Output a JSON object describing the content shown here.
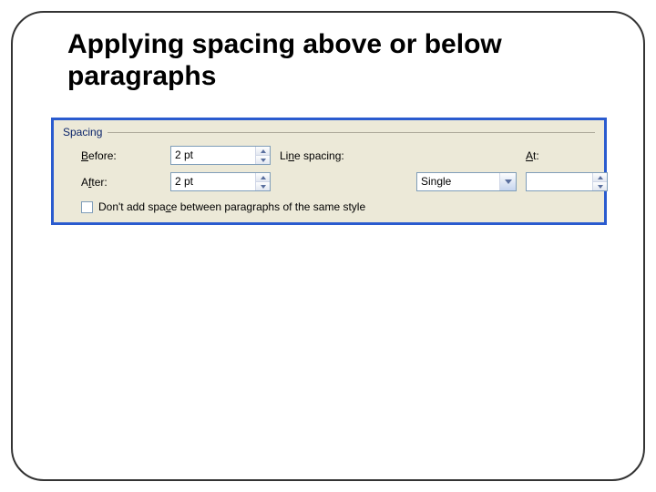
{
  "slide": {
    "title": "Applying spacing above or below paragraphs"
  },
  "spacing": {
    "group": "Spacing",
    "before": {
      "label_pre": "",
      "label_ul": "B",
      "label_post": "efore:",
      "value": "2 pt"
    },
    "after": {
      "label_pre": "A",
      "label_ul": "f",
      "label_post": "ter:",
      "value": "2 pt"
    },
    "line": {
      "label_pre": "Li",
      "label_ul": "n",
      "label_post": "e spacing:",
      "value": "Single"
    },
    "at": {
      "label_pre": "",
      "label_ul": "A",
      "label_post": "t:",
      "value": ""
    },
    "checkbox": {
      "label_pre": "Don't add spa",
      "label_ul": "c",
      "label_post": "e between paragraphs of the same style",
      "checked": false
    }
  }
}
